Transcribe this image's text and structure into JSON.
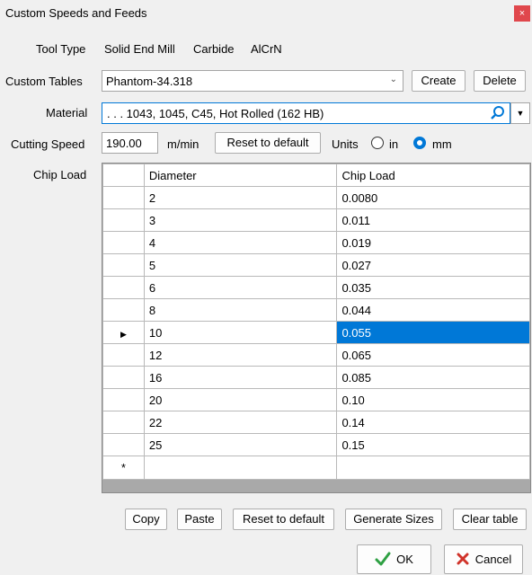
{
  "window": {
    "title": "Custom Speeds and Feeds",
    "close_glyph": "×"
  },
  "tool_type": {
    "label": "Tool Type",
    "values": [
      "Solid End Mill",
      "Carbide",
      "AlCrN"
    ]
  },
  "custom_tables": {
    "label": "Custom Tables",
    "selected": "Phantom-34.318",
    "create_label": "Create",
    "delete_label": "Delete"
  },
  "material": {
    "label": "Material",
    "value": ". . . 1043, 1045, C45, Hot Rolled  (162 HB)"
  },
  "cutting_speed": {
    "label": "Cutting Speed",
    "value": "190.00",
    "unit": "m/min",
    "reset_label": "Reset to default",
    "units_label": "Units",
    "unit_in": "in",
    "unit_mm": "mm",
    "selected_unit": "mm"
  },
  "chip_load": {
    "label": "Chip Load",
    "columns": [
      "Diameter",
      "Chip Load"
    ],
    "rows": [
      {
        "diameter": "2",
        "chip_load": "0.0080"
      },
      {
        "diameter": "3",
        "chip_load": "0.011"
      },
      {
        "diameter": "4",
        "chip_load": "0.019"
      },
      {
        "diameter": "5",
        "chip_load": "0.027"
      },
      {
        "diameter": "6",
        "chip_load": "0.035"
      },
      {
        "diameter": "8",
        "chip_load": "0.044"
      },
      {
        "diameter": "10",
        "chip_load": "0.055"
      },
      {
        "diameter": "12",
        "chip_load": "0.065"
      },
      {
        "diameter": "16",
        "chip_load": "0.085"
      },
      {
        "diameter": "20",
        "chip_load": "0.10"
      },
      {
        "diameter": "22",
        "chip_load": "0.14"
      },
      {
        "diameter": "25",
        "chip_load": "0.15"
      }
    ],
    "current_row_marker": "▶",
    "new_row_marker": "*",
    "selected_row": 6
  },
  "actions": {
    "copy": "Copy",
    "paste": "Paste",
    "reset": "Reset to default",
    "generate": "Generate Sizes",
    "clear": "Clear table"
  },
  "dialog": {
    "ok": "OK",
    "cancel": "Cancel"
  },
  "colors": {
    "accent": "#0078d7",
    "close_bg": "#e0474c",
    "ok_check": "#2ea043",
    "cancel_x": "#d0332a"
  }
}
